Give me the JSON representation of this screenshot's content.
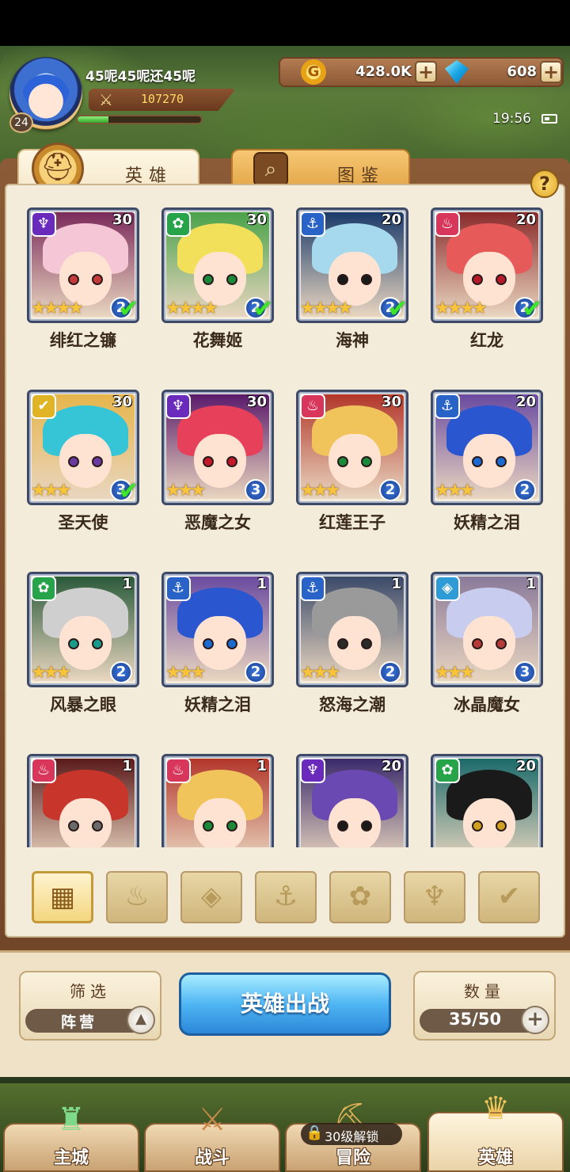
{
  "header": {
    "player_name": "45呢45呢还45呢",
    "player_level": "24",
    "power": "107270",
    "exp_fraction": 0.25,
    "gold": "428.0K",
    "gems": "608",
    "time": "19:56",
    "plus": "+"
  },
  "tabs": {
    "heroes": "英雄",
    "codex": "图鉴",
    "help": "?"
  },
  "faction_colors": {
    "dark": "#6a2bbd",
    "beast": "#27a44a",
    "water": "#2a63c8",
    "fire": "#d8365b",
    "light": "#e0b424",
    "ice": "#2e9ad6"
  },
  "heroes": [
    {
      "name": "绯红之镰",
      "level": "30",
      "faction": "dark",
      "faction_icon": "♆",
      "stars": "★★★★",
      "rank": "2",
      "deployed": true,
      "hair": "#f4c6d6",
      "bg": "#7a2a5a",
      "eye": "#c43a3a"
    },
    {
      "name": "花舞姬",
      "level": "30",
      "faction": "beast",
      "faction_icon": "✿",
      "stars": "★★★★",
      "rank": "2",
      "deployed": true,
      "hair": "#f3e05a",
      "bg": "#4aa24a",
      "eye": "#1a8a3a"
    },
    {
      "name": "海神",
      "level": "20",
      "faction": "water",
      "faction_icon": "⚓",
      "stars": "★★★★",
      "rank": "2",
      "deployed": true,
      "hair": "#a6d8ee",
      "bg": "#1a3a6a",
      "eye": "#1a1a1a"
    },
    {
      "name": "红龙",
      "level": "20",
      "faction": "fire",
      "faction_icon": "♨",
      "stars": "★★★★",
      "rank": "2",
      "deployed": true,
      "hair": "#e65a5a",
      "bg": "#8a2a2a",
      "eye": "#b51a2a"
    },
    {
      "name": "圣天使",
      "level": "30",
      "faction": "light",
      "faction_icon": "✔",
      "stars": "★★★",
      "rank": "3",
      "deployed": true,
      "hair": "#35c5d6",
      "bg": "#e6b54a",
      "eye": "#6a3aa0"
    },
    {
      "name": "恶魔之女",
      "level": "30",
      "faction": "dark",
      "faction_icon": "♆",
      "stars": "★★★",
      "rank": "3",
      "deployed": false,
      "hair": "#e6405a",
      "bg": "#5a1a6a",
      "eye": "#c21a2a"
    },
    {
      "name": "红莲王子",
      "level": "30",
      "faction": "fire",
      "faction_icon": "♨",
      "stars": "★★★",
      "rank": "2",
      "deployed": false,
      "hair": "#f0c45a",
      "bg": "#b2362a",
      "eye": "#1a8a3a"
    },
    {
      "name": "妖精之泪",
      "level": "20",
      "faction": "water",
      "faction_icon": "⚓",
      "stars": "★★★",
      "rank": "2",
      "deployed": false,
      "hair": "#2a56d0",
      "bg": "#6a4aa0",
      "eye": "#1a6ad0"
    },
    {
      "name": "风暴之眼",
      "level": "1",
      "faction": "beast",
      "faction_icon": "✿",
      "stars": "★★★",
      "rank": "2",
      "deployed": false,
      "hair": "#cfcfcf",
      "bg": "#2a5a3a",
      "eye": "#1a9a8a"
    },
    {
      "name": "妖精之泪",
      "level": "1",
      "faction": "water",
      "faction_icon": "⚓",
      "stars": "★★★",
      "rank": "2",
      "deployed": false,
      "hair": "#2a56d0",
      "bg": "#6a4aa0",
      "eye": "#1a6ad0"
    },
    {
      "name": "怒海之潮",
      "level": "1",
      "faction": "water",
      "faction_icon": "⚓",
      "stars": "★★★",
      "rank": "2",
      "deployed": false,
      "hair": "#9a9a9a",
      "bg": "#3a4a6a",
      "eye": "#2a2a2a"
    },
    {
      "name": "冰晶魔女",
      "level": "1",
      "faction": "ice",
      "faction_icon": "◈",
      "stars": "★★★",
      "rank": "3",
      "deployed": false,
      "hair": "#c8ccee",
      "bg": "#8a7a9a",
      "eye": "#b53a3a"
    },
    {
      "name": "",
      "level": "1",
      "faction": "fire",
      "faction_icon": "♨",
      "stars": "",
      "rank": "",
      "deployed": false,
      "hair": "#c8352a",
      "bg": "#5a1a1a",
      "eye": "#6a6a6a"
    },
    {
      "name": "",
      "level": "1",
      "faction": "fire",
      "faction_icon": "♨",
      "stars": "",
      "rank": "",
      "deployed": false,
      "hair": "#f0c45a",
      "bg": "#b2362a",
      "eye": "#1a8a3a"
    },
    {
      "name": "",
      "level": "20",
      "faction": "dark",
      "faction_icon": "♆",
      "stars": "",
      "rank": "",
      "deployed": false,
      "hair": "#6a4ab2",
      "bg": "#3a2a6a",
      "eye": "#1a1a1a"
    },
    {
      "name": "",
      "level": "20",
      "faction": "beast",
      "faction_icon": "✿",
      "stars": "",
      "rank": "",
      "deployed": false,
      "hair": "#1a1a1a",
      "bg": "#1a6a6a",
      "eye": "#d0a020"
    }
  ],
  "faction_filters": [
    {
      "icon": "▦",
      "name": "all",
      "active": true
    },
    {
      "icon": "♨",
      "name": "fire",
      "active": false
    },
    {
      "icon": "◈",
      "name": "ice",
      "active": false
    },
    {
      "icon": "⚓",
      "name": "water",
      "active": false
    },
    {
      "icon": "✿",
      "name": "beast",
      "active": false
    },
    {
      "icon": "♆",
      "name": "dark",
      "active": false
    },
    {
      "icon": "✔",
      "name": "light",
      "active": false
    }
  ],
  "controls": {
    "filter_title": "筛选",
    "filter_value": "阵营",
    "deploy_label": "英雄出战",
    "count_title": "数量",
    "count_value": "35/50"
  },
  "nav": [
    {
      "label": "主城",
      "icon": "♜"
    },
    {
      "label": "战斗",
      "icon": "⚔"
    },
    {
      "label": "冒险",
      "icon": "⛏"
    },
    {
      "label": "英雄",
      "icon": "♛"
    }
  ],
  "nav_lock": "30级解锁"
}
